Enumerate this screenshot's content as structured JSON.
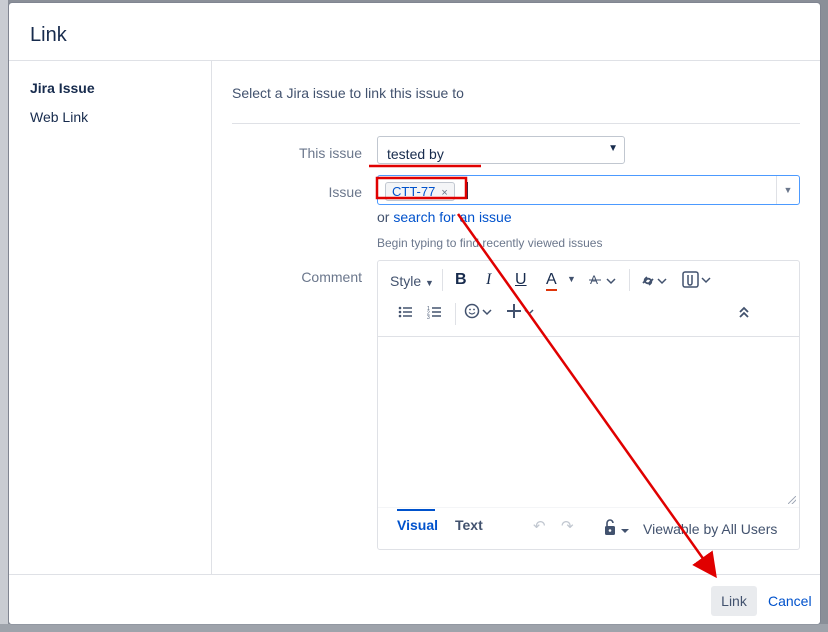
{
  "dialog": {
    "title": "Link",
    "nav": [
      {
        "label": "Jira Issue",
        "active": true
      },
      {
        "label": "Web Link",
        "active": false
      }
    ],
    "intro": "Select a Jira issue to link this issue to",
    "this_issue": {
      "label": "This issue",
      "value": "tested by"
    },
    "issue": {
      "label": "Issue",
      "token": "CTT-77",
      "remove_glyph": "×"
    },
    "search": {
      "prefix": "or",
      "link": "search for an issue"
    },
    "hint": "Begin typing to find recently viewed issues",
    "comment": {
      "label": "Comment",
      "toolbar": {
        "style": "Style",
        "bold": "B",
        "italic": "I",
        "underline": "U",
        "text_color": "A",
        "text_color_accent": "#de350b"
      },
      "tabs": {
        "visual": "Visual",
        "text": "Text"
      },
      "visibility": "Viewable by All Users"
    },
    "footer": {
      "primary": "Link",
      "cancel": "Cancel"
    }
  },
  "annotation_color": "#e00000"
}
